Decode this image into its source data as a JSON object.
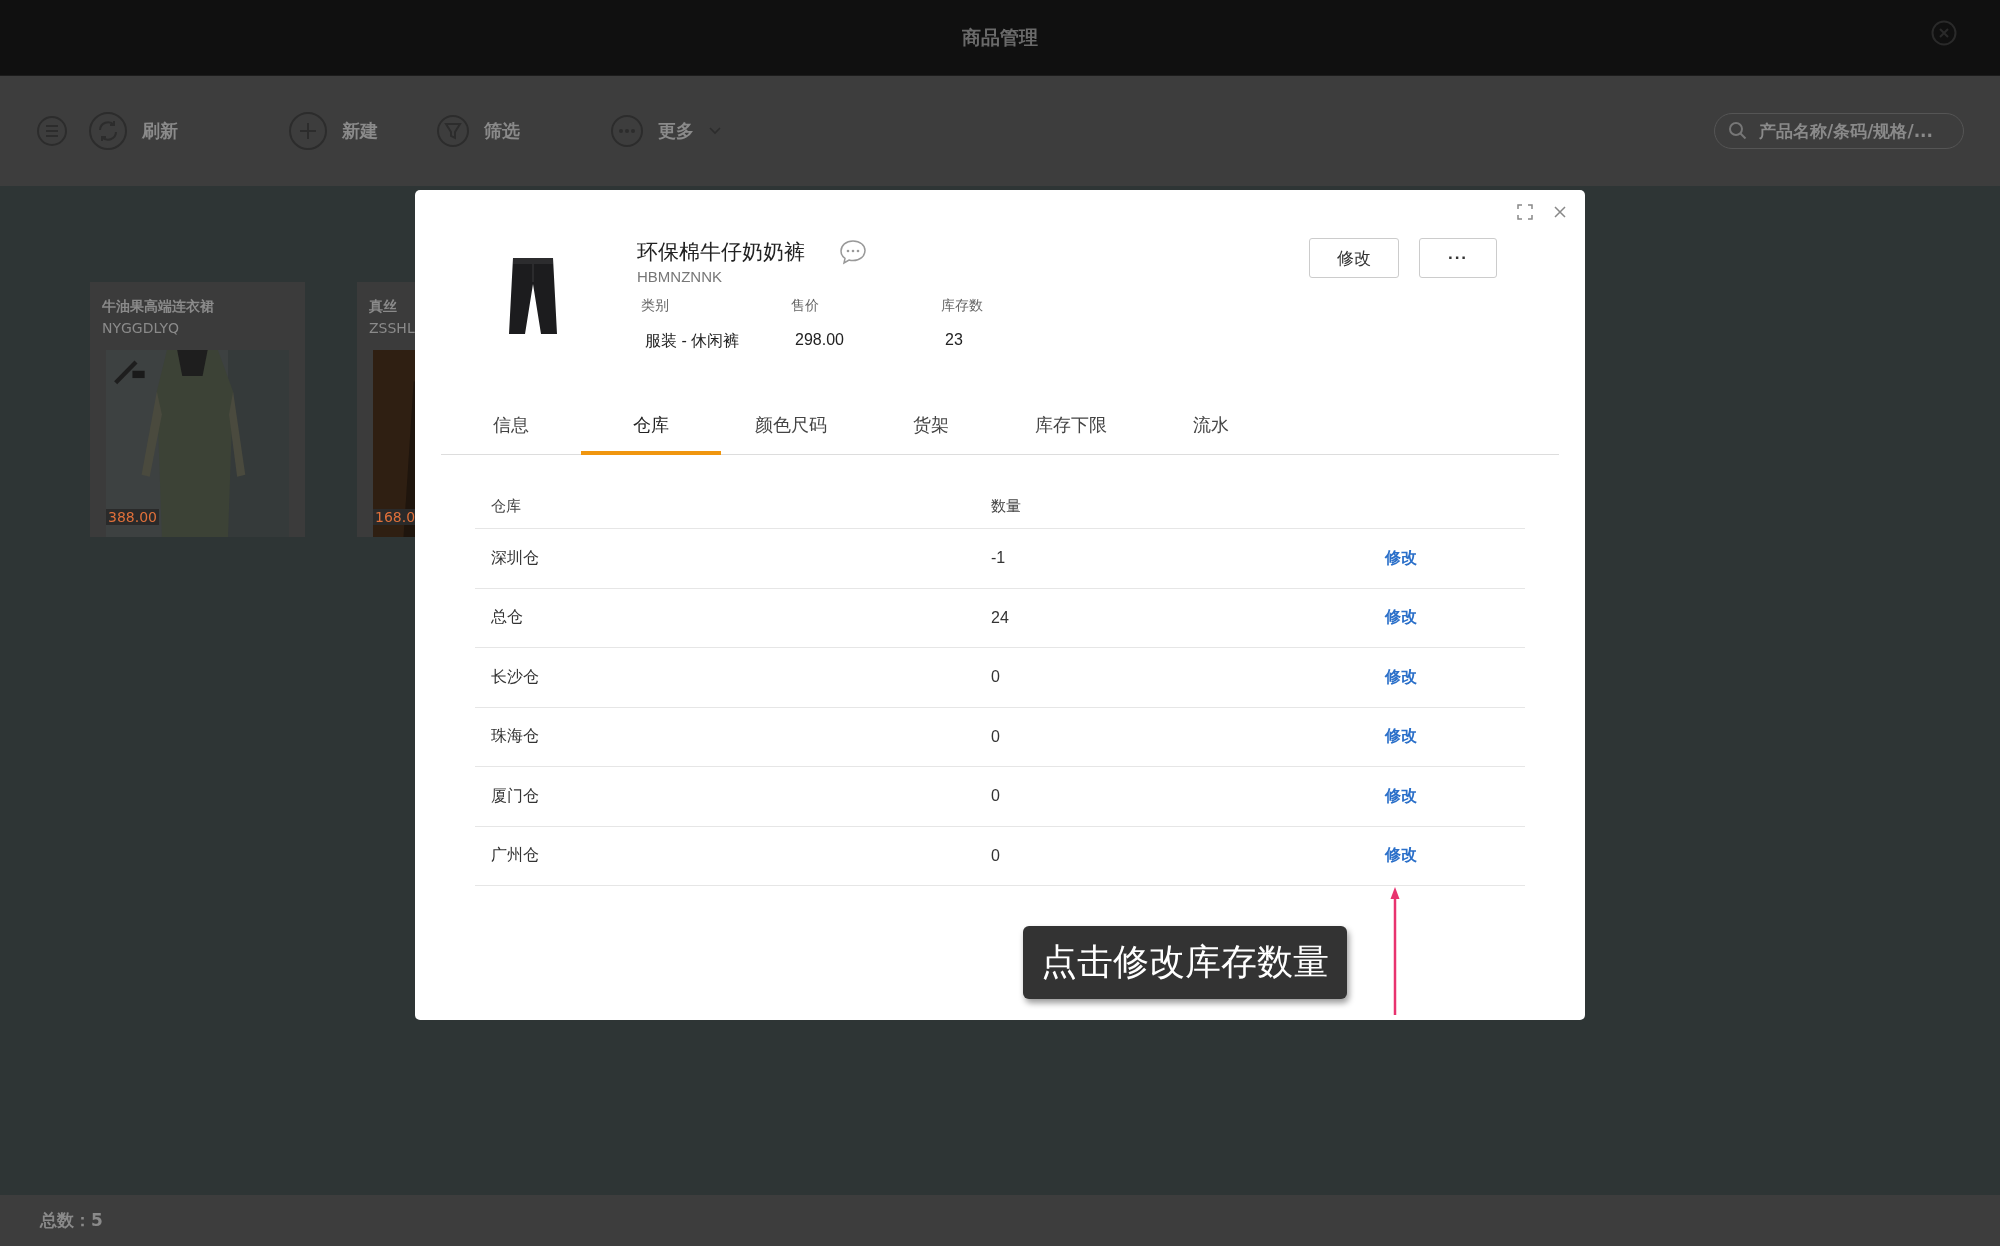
{
  "window": {
    "title": "商品管理"
  },
  "toolbar": {
    "buttons": [
      {
        "kind": "refresh",
        "label": "刷新"
      },
      {
        "kind": "add",
        "label": "新建"
      },
      {
        "kind": "filter",
        "label": "筛选"
      },
      {
        "kind": "more",
        "label": "更多"
      }
    ],
    "search": {
      "placeholder": "产品名称/条码/规格/..."
    }
  },
  "cards": [
    {
      "name": "牛油果高端连衣裙",
      "code": "NYGGDLYQ",
      "price": "388.00"
    },
    {
      "name": "真丝",
      "code": "ZSSHL",
      "price": "168.0"
    }
  ],
  "status_bar": {
    "total": "总数：5"
  },
  "dialog": {
    "product": {
      "name": "环保棉牛仔奶奶裤",
      "code": "HBMNZNNK",
      "fields": [
        {
          "label": "类别",
          "value": "服装 - 休闲裤"
        },
        {
          "label": "售价",
          "value": "298.00"
        },
        {
          "label": "库存数",
          "value": "23"
        }
      ]
    },
    "actions": [
      "修改",
      "···"
    ],
    "tabs": [
      {
        "label": "信息",
        "selected": false
      },
      {
        "label": "仓库",
        "selected": true
      },
      {
        "label": "颜色尺码",
        "selected": false
      },
      {
        "label": "货架",
        "selected": false
      },
      {
        "label": "库存下限",
        "selected": false
      },
      {
        "label": "流水",
        "selected": false
      }
    ],
    "table": {
      "columns": [
        "仓库",
        "数量"
      ],
      "rows": [
        {
          "warehouse": "深圳仓",
          "quantity": "-1",
          "action": "修改"
        },
        {
          "warehouse": "总仓",
          "quantity": "24",
          "action": "修改"
        },
        {
          "warehouse": "长沙仓",
          "quantity": "0",
          "action": "修改"
        },
        {
          "warehouse": "珠海仓",
          "quantity": "0",
          "action": "修改"
        },
        {
          "warehouse": "厦门仓",
          "quantity": "0",
          "action": "修改"
        },
        {
          "warehouse": "广州仓",
          "quantity": "0",
          "action": "修改"
        }
      ]
    },
    "tooltip": "点击修改库存数量"
  }
}
